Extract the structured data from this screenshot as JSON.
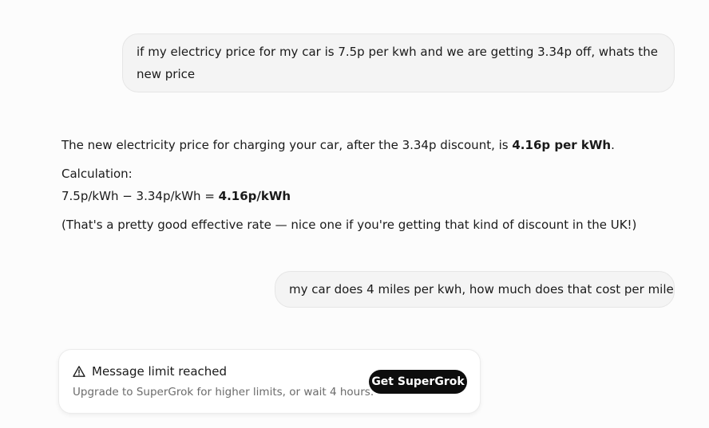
{
  "conversation": {
    "user_message_1": "if my electricy price for my car is 7.5p per kwh and we are getting 3.34p off, whats the new price",
    "assistant": {
      "para1_prefix": "The new electricity price for charging your car, after the 3.34p discount, is ",
      "para1_bold": "4.16p per kWh",
      "para1_suffix": ".",
      "calc_label": "Calculation:",
      "calc_expr": "7.5p/kWh − 3.34p/kWh = ",
      "calc_result": "4.16p/kWh",
      "para3": "(That's a pretty good effective rate — nice one if you're getting that kind of discount in the UK!)"
    },
    "user_message_2": "my car does 4 miles per kwh, how much does that cost per mile"
  },
  "limit_notice": {
    "icon": "warning-triangle-icon",
    "title": "Message limit reached",
    "subtitle": "Upgrade to SuperGrok for higher limits, or wait 4 hours.",
    "button_label": "Get SuperGrok"
  }
}
